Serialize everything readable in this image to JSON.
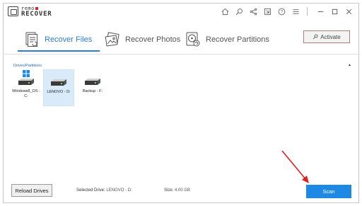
{
  "app": {
    "logo_line1": "remo",
    "logo_line2": "RECOVER"
  },
  "titlebar": {
    "icons": [
      "home-icon",
      "search-icon",
      "share-icon",
      "feedback-icon",
      "help-icon",
      "menu-icon",
      "minimize-icon",
      "close-icon"
    ]
  },
  "tabs": [
    {
      "label": "Recover Files",
      "icon": "recover-files-icon",
      "active": true
    },
    {
      "label": "Recover Photos",
      "icon": "recover-photos-icon",
      "active": false
    },
    {
      "label": "Recover Partitions",
      "icon": "recover-partitions-icon",
      "active": false
    }
  ],
  "activate": {
    "label": "Activate"
  },
  "drives": {
    "section_title": "Drives/Partitions",
    "items": [
      {
        "label": "Windows8_OS - C:",
        "selected": false
      },
      {
        "label": "LENOVO - D:",
        "selected": true
      },
      {
        "label": "Backup - F:",
        "selected": false
      }
    ]
  },
  "footer": {
    "reload_label": "Reload Drives",
    "selected_drive_label": "Selected Drive:",
    "selected_drive_value": "LENOVO - D:",
    "size_label": "Size:",
    "size_value": "4.00 GB",
    "scan_label": "Scan"
  },
  "colors": {
    "accent": "#2b7dd6",
    "scan_button": "#1e88e5",
    "selected_drive_bg": "#d9ebf9",
    "annotation_arrow": "#e02020"
  }
}
